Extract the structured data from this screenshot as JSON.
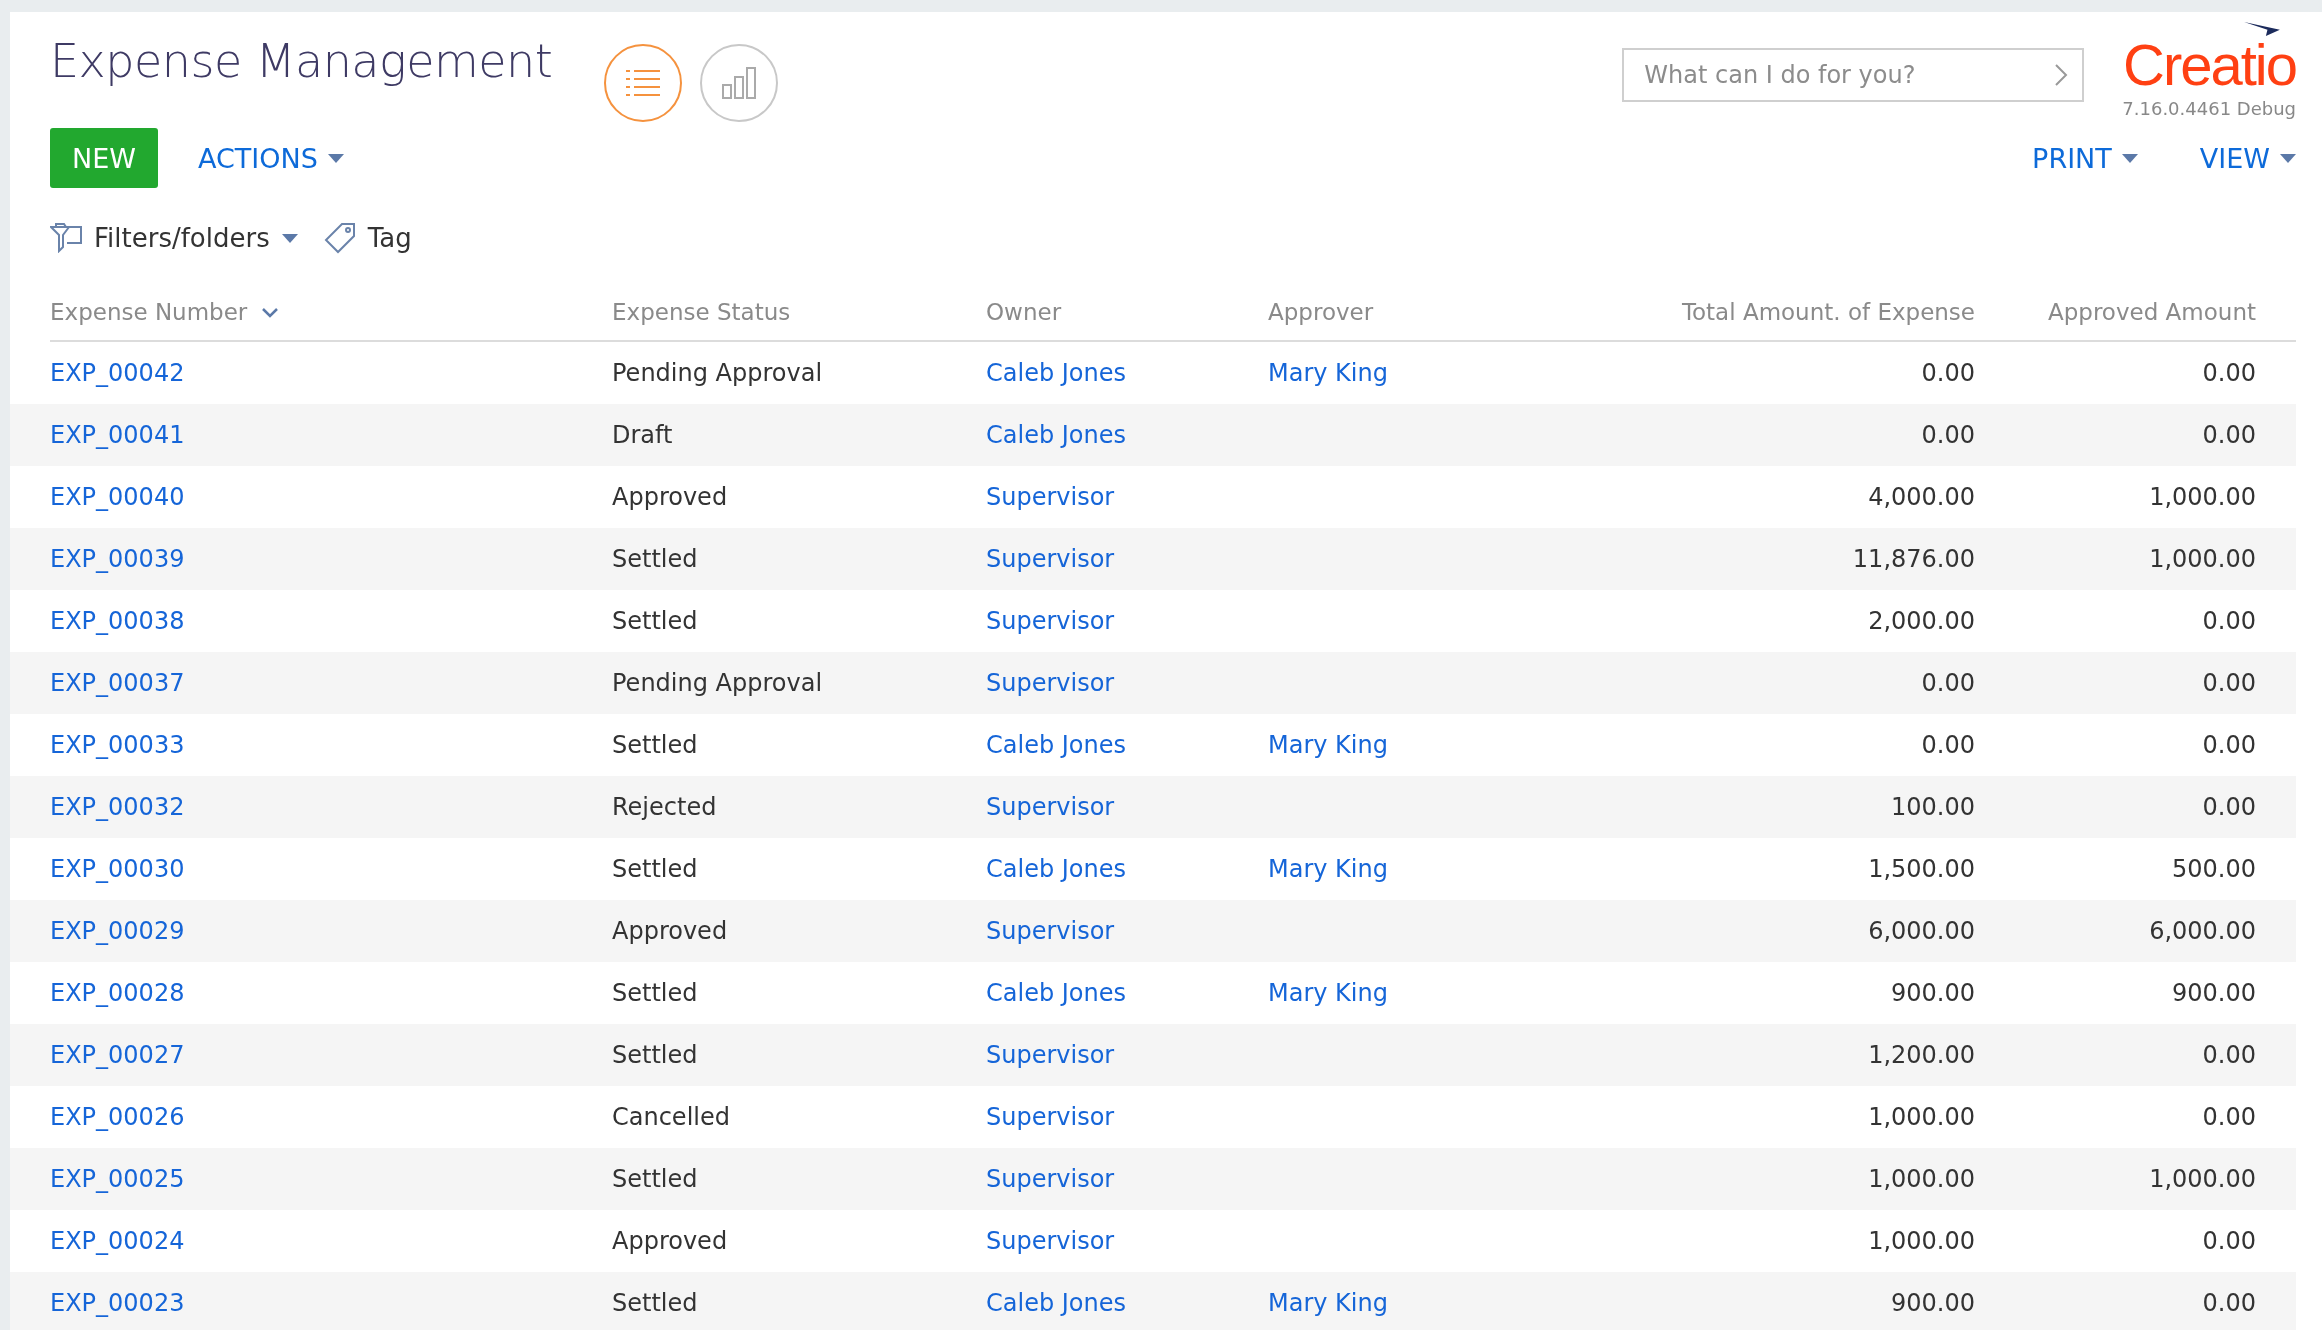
{
  "header": {
    "title": "Expense Management",
    "views": [
      {
        "kind": "list",
        "selected": true
      },
      {
        "kind": "chart",
        "selected": false
      }
    ],
    "search": {
      "placeholder": "What can I do for you?"
    },
    "logo": {
      "text": "Creatio",
      "version": "7.16.0.4461 Debug"
    }
  },
  "toolbar": {
    "new_button": "NEW",
    "actions": "ACTIONS",
    "print": "PRINT",
    "view": "VIEW"
  },
  "filters": {
    "folders": "Filters/folders",
    "tag": "Tag"
  },
  "table": {
    "columns": [
      {
        "label": "Expense Number",
        "sorted": true
      },
      {
        "label": "Expense Status",
        "sorted": false
      },
      {
        "label": "Owner",
        "sorted": false
      },
      {
        "label": "Approver",
        "sorted": false
      },
      {
        "label": "Total Amount. of Expense",
        "sorted": false
      },
      {
        "label": "Approved Amount",
        "sorted": false
      }
    ],
    "rows": [
      {
        "number": "EXP_00042",
        "status": "Pending Approval",
        "owner": "Caleb Jones",
        "approver": "Mary King",
        "total": "0.00",
        "approved": "0.00"
      },
      {
        "number": "EXP_00041",
        "status": "Draft",
        "owner": "Caleb Jones",
        "total": "0.00",
        "approved": "0.00"
      },
      {
        "number": "EXP_00040",
        "status": "Approved",
        "owner": "Supervisor",
        "total": "4,000.00",
        "approved": "1,000.00"
      },
      {
        "number": "EXP_00039",
        "status": "Settled",
        "owner": "Supervisor",
        "total": "11,876.00",
        "approved": "1,000.00"
      },
      {
        "number": "EXP_00038",
        "status": "Settled",
        "owner": "Supervisor",
        "total": "2,000.00",
        "approved": "0.00"
      },
      {
        "number": "EXP_00037",
        "status": "Pending Approval",
        "owner": "Supervisor",
        "total": "0.00",
        "approved": "0.00"
      },
      {
        "number": "EXP_00033",
        "status": "Settled",
        "owner": "Caleb Jones",
        "approver": "Mary King",
        "total": "0.00",
        "approved": "0.00"
      },
      {
        "number": "EXP_00032",
        "status": "Rejected",
        "owner": "Supervisor",
        "total": "100.00",
        "approved": "0.00"
      },
      {
        "number": "EXP_00030",
        "status": "Settled",
        "owner": "Caleb Jones",
        "approver": "Mary King",
        "total": "1,500.00",
        "approved": "500.00"
      },
      {
        "number": "EXP_00029",
        "status": "Approved",
        "owner": "Supervisor",
        "total": "6,000.00",
        "approved": "6,000.00"
      },
      {
        "number": "EXP_00028",
        "status": "Settled",
        "owner": "Caleb Jones",
        "approver": "Mary King",
        "total": "900.00",
        "approved": "900.00"
      },
      {
        "number": "EXP_00027",
        "status": "Settled",
        "owner": "Supervisor",
        "total": "1,200.00",
        "approved": "0.00"
      },
      {
        "number": "EXP_00026",
        "status": "Cancelled",
        "owner": "Supervisor",
        "total": "1,000.00",
        "approved": "0.00"
      },
      {
        "number": "EXP_00025",
        "status": "Settled",
        "owner": "Supervisor",
        "total": "1,000.00",
        "approved": "1,000.00"
      },
      {
        "number": "EXP_00024",
        "status": "Approved",
        "owner": "Supervisor",
        "total": "1,000.00",
        "approved": "0.00"
      },
      {
        "number": "EXP_00023",
        "status": "Settled",
        "owner": "Caleb Jones",
        "approver": "Mary King",
        "total": "900.00",
        "approved": "0.00"
      }
    ]
  }
}
